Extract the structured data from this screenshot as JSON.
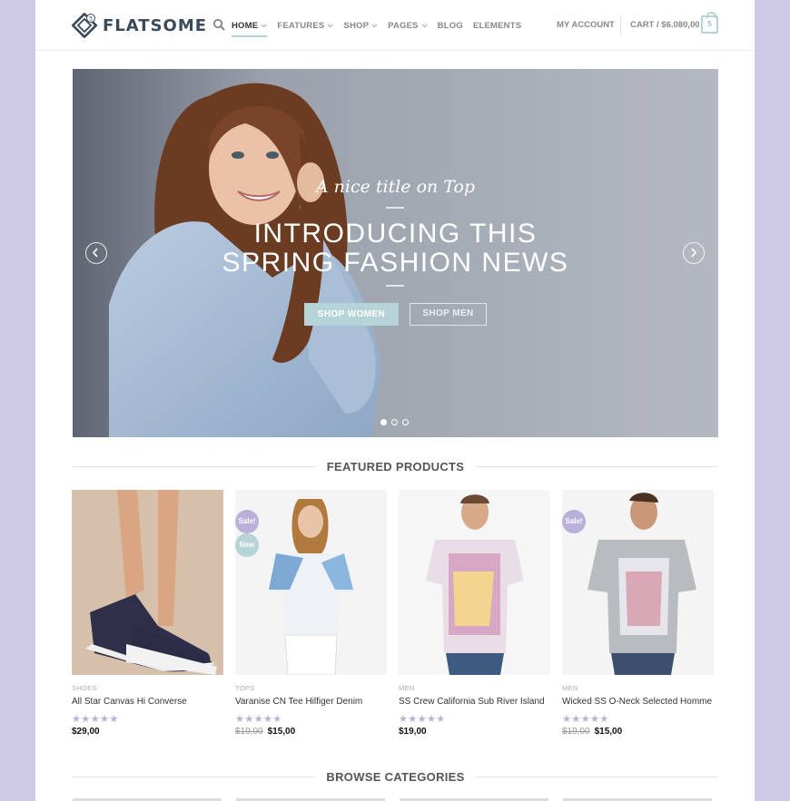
{
  "header": {
    "logo_text": "FLATSOME",
    "logo_badge": "3",
    "nav": [
      {
        "label": "HOME",
        "dropdown": true,
        "active": true
      },
      {
        "label": "FEATURES",
        "dropdown": true
      },
      {
        "label": "SHOP",
        "dropdown": true
      },
      {
        "label": "PAGES",
        "dropdown": true
      },
      {
        "label": "BLOG",
        "dropdown": false
      },
      {
        "label": "ELEMENTS",
        "dropdown": false
      }
    ],
    "account": "MY ACCOUNT",
    "cart": "CART / $6.080,00",
    "cart_count": "5"
  },
  "hero": {
    "subtitle": "A nice title on Top",
    "title_line1": "INTRODUCING THIS",
    "title_line2": "SPRING FASHION NEWS",
    "button_primary": "SHOP WOMEN",
    "button_secondary": "SHOP MEN",
    "slides": 3,
    "active_slide": 0
  },
  "sections": {
    "featured": "FEATURED PRODUCTS",
    "browse": "BROWSE CATEGORIES"
  },
  "products": [
    {
      "category": "SHOES",
      "name": "All Star Canvas Hi Converse",
      "rating": 5,
      "price": "$29,00",
      "old_price": "",
      "badges": []
    },
    {
      "category": "TOPS",
      "name": "Varanise CN Tee Hilfiger Denim",
      "rating": 4,
      "price": "$15,00",
      "old_price": "$19,00",
      "badges": [
        "Sale!",
        "New"
      ]
    },
    {
      "category": "MEN",
      "name": "SS Crew California Sub River Island",
      "rating": 4,
      "price": "$19,00",
      "old_price": "",
      "badges": []
    },
    {
      "category": "MEN",
      "name": "Wicked SS O-Neck Selected Homme",
      "rating": 4,
      "price": "$15,00",
      "old_price": "$19,00",
      "badges": [
        "Sale!"
      ]
    }
  ],
  "colors": {
    "accent": "#b6d3d8",
    "sale": "#b9b1d9",
    "background": "#cfc9e8"
  }
}
